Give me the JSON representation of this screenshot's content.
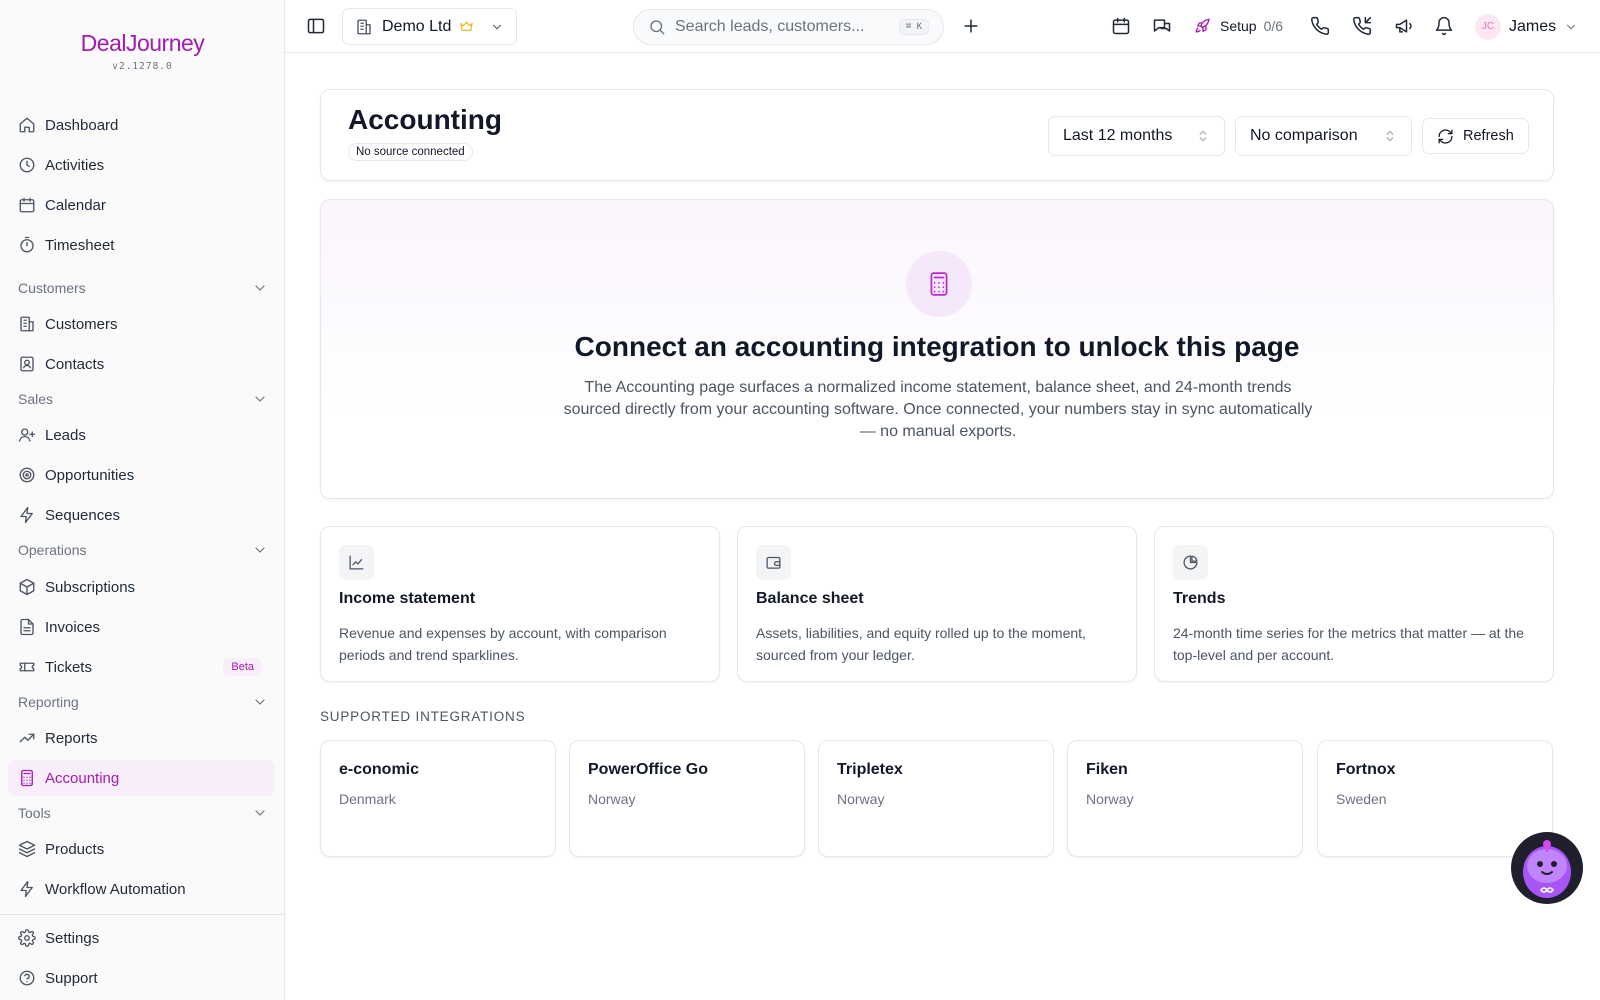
{
  "brand": {
    "logo": "DealJourney",
    "version": "v2.1278.0"
  },
  "sidebar": {
    "items": {
      "dashboard": "Dashboard",
      "activities": "Activities",
      "calendar": "Calendar",
      "timesheet": "Timesheet",
      "customers": "Customers",
      "contacts": "Contacts",
      "leads": "Leads",
      "opportunities": "Opportunities",
      "sequences": "Sequences",
      "subscriptions": "Subscriptions",
      "invoices": "Invoices",
      "tickets": "Tickets",
      "reports": "Reports",
      "accounting": "Accounting",
      "products": "Products",
      "workflow": "Workflow Automation",
      "settings": "Settings",
      "support": "Support"
    },
    "sections": {
      "customers": "Customers",
      "sales": "Sales",
      "operations": "Operations",
      "reporting": "Reporting",
      "tools": "Tools"
    },
    "tickets_badge": "Beta",
    "active": "accounting"
  },
  "topbar": {
    "org": "Demo Ltd",
    "search_placeholder": "Search leads, customers...",
    "search_shortcut": "⌘ K",
    "setup_label": "Setup",
    "setup_progress": "0/6",
    "user_initials": "JC",
    "user_name": "James"
  },
  "header": {
    "title": "Accounting",
    "badge": "No source connected",
    "period": "Last 12 months",
    "comparison": "No comparison",
    "refresh": "Refresh"
  },
  "hero": {
    "title": "Connect an accounting integration to unlock this page",
    "description": "The Accounting page surfaces a normalized income statement, balance sheet, and 24-month trends sourced directly from your accounting software. Once connected, your numbers stay in sync automatically — no manual exports."
  },
  "features": [
    {
      "title": "Income statement",
      "description": "Revenue and expenses by account, with comparison periods and trend sparklines.",
      "icon": "line-chart-icon"
    },
    {
      "title": "Balance sheet",
      "description": "Assets, liabilities, and equity rolled up to the moment, sourced from your ledger.",
      "icon": "wallet-icon"
    },
    {
      "title": "Trends",
      "description": "24-month time series for the metrics that matter — at the top-level and per account.",
      "icon": "pie-chart-icon"
    }
  ],
  "integrations": {
    "label": "SUPPORTED INTEGRATIONS",
    "items": [
      {
        "name": "e-conomic",
        "country": "Denmark"
      },
      {
        "name": "PowerOffice Go",
        "country": "Norway"
      },
      {
        "name": "Tripletex",
        "country": "Norway"
      },
      {
        "name": "Fiken",
        "country": "Norway"
      },
      {
        "name": "Fortnox",
        "country": "Sweden"
      }
    ]
  },
  "colors": {
    "accent": "#a21caf",
    "accent_bg": "#f7eefa",
    "border": "#e5e7eb"
  }
}
